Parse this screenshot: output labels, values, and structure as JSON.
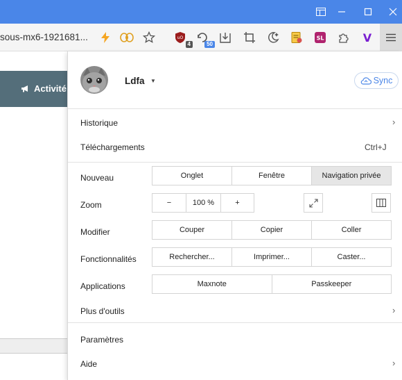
{
  "browser": {
    "url_text": "sous-mx6-1921681...",
    "extensions": [
      {
        "icon": "bolt-icon"
      },
      {
        "icon": "bee-icon"
      },
      {
        "icon": "star-icon"
      },
      {
        "icon": "ublock-icon",
        "badge": "4"
      },
      {
        "icon": "translate-icon",
        "badge": "50"
      },
      {
        "icon": "download-icon"
      },
      {
        "icon": "crop-icon"
      },
      {
        "icon": "dark-mode-icon"
      },
      {
        "icon": "notes-icon"
      },
      {
        "icon": "sl-icon",
        "label": "SL"
      },
      {
        "icon": "puzzle-icon"
      },
      {
        "icon": "vivaldi-icon",
        "label": "V"
      }
    ],
    "colors": {
      "titlebar": "#4a86e8",
      "accent": "#4a86e8"
    }
  },
  "page": {
    "banner_text": "Activité"
  },
  "menu": {
    "profile": {
      "name": "Ldfa",
      "sync_label": "Sync"
    },
    "history_label": "Historique",
    "downloads_label": "Téléchargements",
    "downloads_shortcut": "Ctrl+J",
    "new_label": "Nouveau",
    "new_buttons": [
      "Onglet",
      "Fenêtre",
      "Navigation privée"
    ],
    "zoom_label": "Zoom",
    "zoom": {
      "minus": "−",
      "value": "100 %",
      "plus": "+"
    },
    "edit_label": "Modifier",
    "edit_buttons": [
      "Couper",
      "Copier",
      "Coller"
    ],
    "features_label": "Fonctionnalités",
    "features_buttons": [
      "Rechercher...",
      "Imprimer...",
      "Caster..."
    ],
    "apps_label": "Applications",
    "apps_buttons": [
      "Maxnote",
      "Passkeeper"
    ],
    "more_tools_label": "Plus d'outils",
    "settings_label": "Paramètres",
    "help_label": "Aide"
  }
}
